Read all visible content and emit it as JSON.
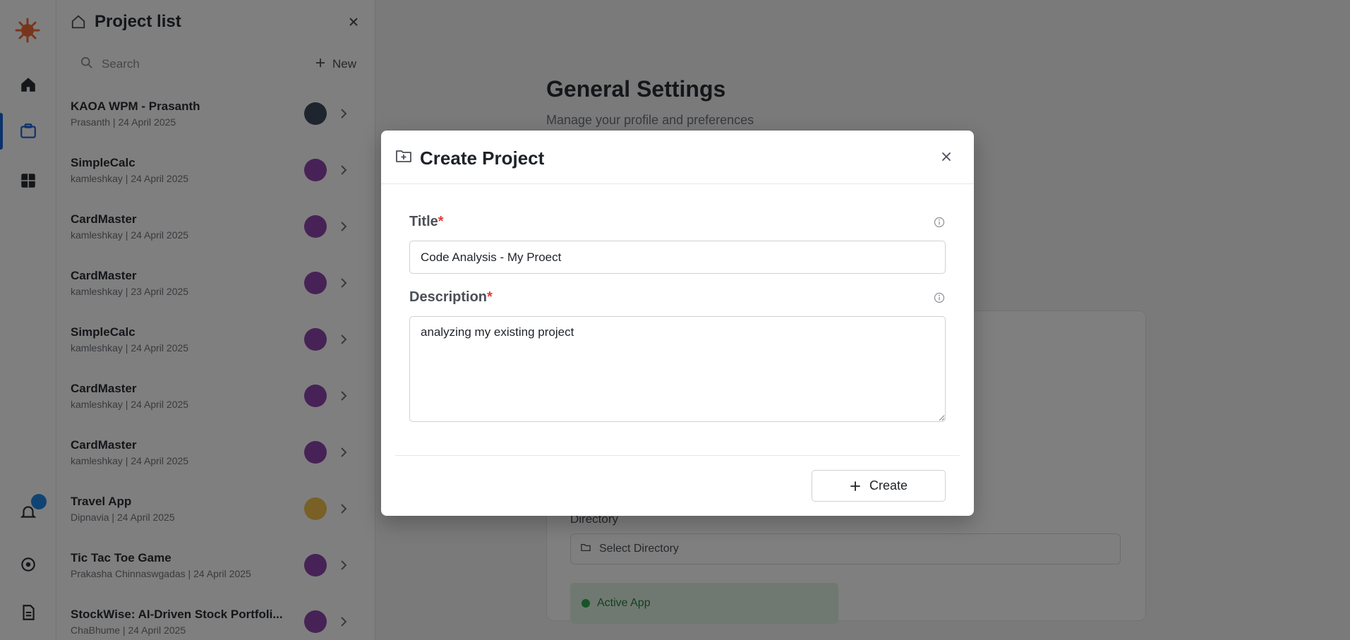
{
  "colors": {
    "accent": "#1565d8",
    "brand": "#f26b38",
    "required": "#e53935",
    "overlay": "rgba(0,0,0,0.5)"
  },
  "rail": {
    "icons": [
      "app-logo-icon",
      "home-icon",
      "projects-icon",
      "grid-icon",
      "notifications-icon",
      "settings-icon",
      "document-icon"
    ]
  },
  "project_panel": {
    "title": "Project list",
    "search_placeholder": "Search",
    "new_label": "New",
    "items": [
      {
        "name": "KAOA WPM - Prasanth",
        "meta": "Prasanth | 24 April 2025",
        "avatar_color": "#3d4a5c"
      },
      {
        "name": "SimpleCalc",
        "meta": "kamleshkay | 24 April 2025",
        "avatar_color": "#8e44ad"
      },
      {
        "name": "CardMaster",
        "meta": "kamleshkay | 24 April 2025",
        "avatar_color": "#8e44ad"
      },
      {
        "name": "CardMaster",
        "meta": "kamleshkay | 23 April 2025",
        "avatar_color": "#8e44ad"
      },
      {
        "name": "SimpleCalc",
        "meta": "kamleshkay | 24 April 2025",
        "avatar_color": "#8e44ad"
      },
      {
        "name": "CardMaster",
        "meta": "kamleshkay | 24 April 2025",
        "avatar_color": "#8e44ad"
      },
      {
        "name": "CardMaster",
        "meta": "kamleshkay | 24 April 2025",
        "avatar_color": "#8e44ad"
      },
      {
        "name": "Travel App",
        "meta": "Dipnavia | 24 April 2025",
        "avatar_color": "#f2c14e"
      },
      {
        "name": "Tic Tac Toe Game",
        "meta": "Prakasha Chinnaswgadas | 24 April 2025",
        "avatar_color": "#8e44ad"
      },
      {
        "name": "StockWise: AI-Driven Stock Portfoli...",
        "meta": "ChaBhume | 24 April 2025",
        "avatar_color": "#8e44ad"
      }
    ]
  },
  "background_page": {
    "title": "General Settings",
    "subtitle": "Manage your profile and preferences",
    "directory_label": "Directory",
    "directory_value": "Select Directory",
    "status_text": "Active App"
  },
  "modal": {
    "title": "Create Project",
    "title_label": "Title",
    "title_value": "Code Analysis - My Proect",
    "description_label": "Description",
    "description_value": "analyzing my existing project",
    "required_mark": "*",
    "create_label": "Create"
  }
}
